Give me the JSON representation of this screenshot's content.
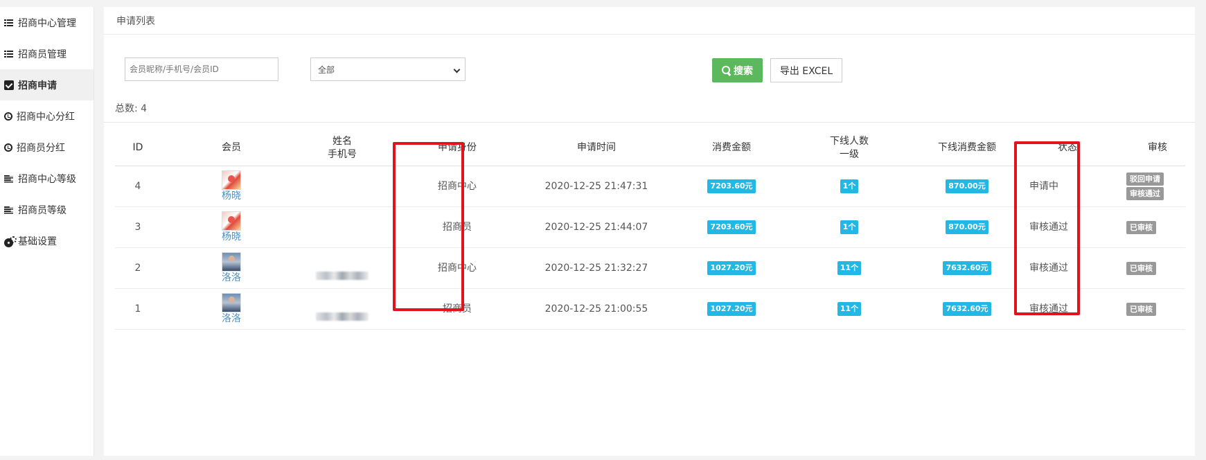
{
  "sidebar": {
    "items": [
      {
        "label": "招商中心管理",
        "icon": "list-icon"
      },
      {
        "label": "招商员管理",
        "icon": "list-icon"
      },
      {
        "label": "招商申请",
        "icon": "check-square-icon",
        "active": true
      },
      {
        "label": "招商中心分红",
        "icon": "clock-icon"
      },
      {
        "label": "招商员分红",
        "icon": "clock-icon"
      },
      {
        "label": "招商中心等级",
        "icon": "align-left-icon"
      },
      {
        "label": "招商员等级",
        "icon": "align-left-icon"
      },
      {
        "label": "基础设置",
        "icon": "gears-icon"
      }
    ]
  },
  "panel": {
    "title": "申请列表"
  },
  "filters": {
    "search_placeholder": "会员昵称/手机号/会员ID",
    "status_selected": "全部",
    "search_button": "搜索",
    "export_button": "导出 EXCEL"
  },
  "summary": {
    "total_label": "总数: 4"
  },
  "table": {
    "headers": {
      "id": "ID",
      "member": "会员",
      "name": "姓名",
      "phone": "手机号",
      "role": "申请身份",
      "time": "申请时间",
      "spend": "消费金额",
      "downline": "下线人数",
      "level": "一级",
      "downline_spend": "下线消费金额",
      "status": "状态",
      "audit": "审核"
    },
    "rows": [
      {
        "id": "4",
        "member": "杨晓",
        "role": "招商中心",
        "time": "2020-12-25 21:47:31",
        "spend": "7203.60元",
        "count": "1个",
        "down_spend": "870.00元",
        "status": "申请中",
        "actions": [
          "驳回申请",
          "审核通过"
        ]
      },
      {
        "id": "3",
        "member": "杨晓",
        "role": "招商员",
        "time": "2020-12-25 21:44:07",
        "spend": "7203.60元",
        "count": "1个",
        "down_spend": "870.00元",
        "status": "审核通过",
        "actions": [
          "已审核"
        ]
      },
      {
        "id": "2",
        "member": "洛洛",
        "role": "招商中心",
        "time": "2020-12-25 21:32:27",
        "spend": "1027.20元",
        "count": "11个",
        "down_spend": "7632.60元",
        "status": "审核通过",
        "actions": [
          "已审核"
        ]
      },
      {
        "id": "1",
        "member": "洛洛",
        "role": "招商员",
        "time": "2020-12-25 21:00:55",
        "spend": "1027.20元",
        "count": "11个",
        "down_spend": "7632.60元",
        "status": "审核通过",
        "actions": [
          "已审核"
        ]
      }
    ]
  },
  "colors": {
    "search_green": "#5cb85c",
    "badge_blue": "#23b7e5",
    "action_gray": "#999999",
    "highlight_red": "#e0141e",
    "member_link": "#4a8fc8"
  }
}
